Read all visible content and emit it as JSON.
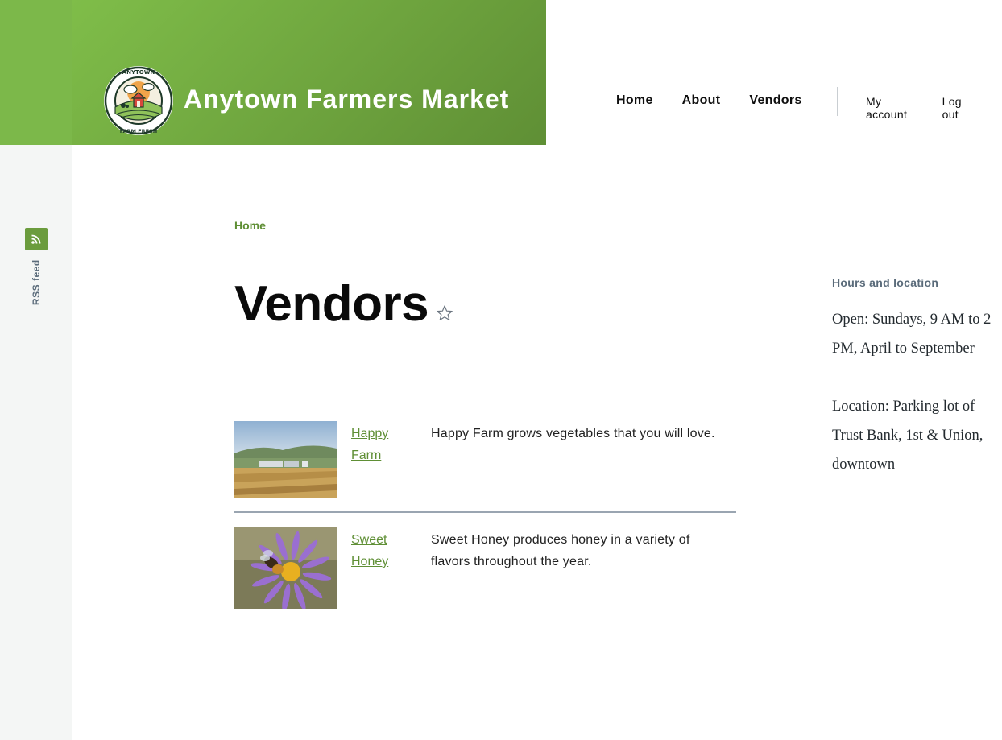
{
  "sidebar_rail": {
    "rss_label": "RSS feed"
  },
  "site": {
    "name": "Anytown Farmers Market",
    "logo_text": "ANYTOWN FARMERS MARKET · FARM FRESH FOOD"
  },
  "main_nav": [
    {
      "label": "Home"
    },
    {
      "label": "About"
    },
    {
      "label": "Vendors"
    }
  ],
  "account_nav": [
    {
      "label": "My account"
    },
    {
      "label": "Log out"
    }
  ],
  "breadcrumb": {
    "home": "Home"
  },
  "page": {
    "title": "Vendors"
  },
  "vendors": [
    {
      "name": "Happy Farm",
      "description": "Happy Farm grows vegetables that you will love."
    },
    {
      "name": "Sweet Honey",
      "description": "Sweet Honey produces honey in a variety of flavors throughout the year."
    }
  ],
  "sidebar": {
    "heading": "Hours and location",
    "hours": "Open: Sundays, 9 AM to 2 PM, April to September",
    "location": "Location: Parking lot of Trust Bank, 1st & Union, downtown"
  },
  "colors": {
    "brand_green": "#6ea43e",
    "link_green": "#5f8f35",
    "rail_bg": "#f4f6f5"
  }
}
